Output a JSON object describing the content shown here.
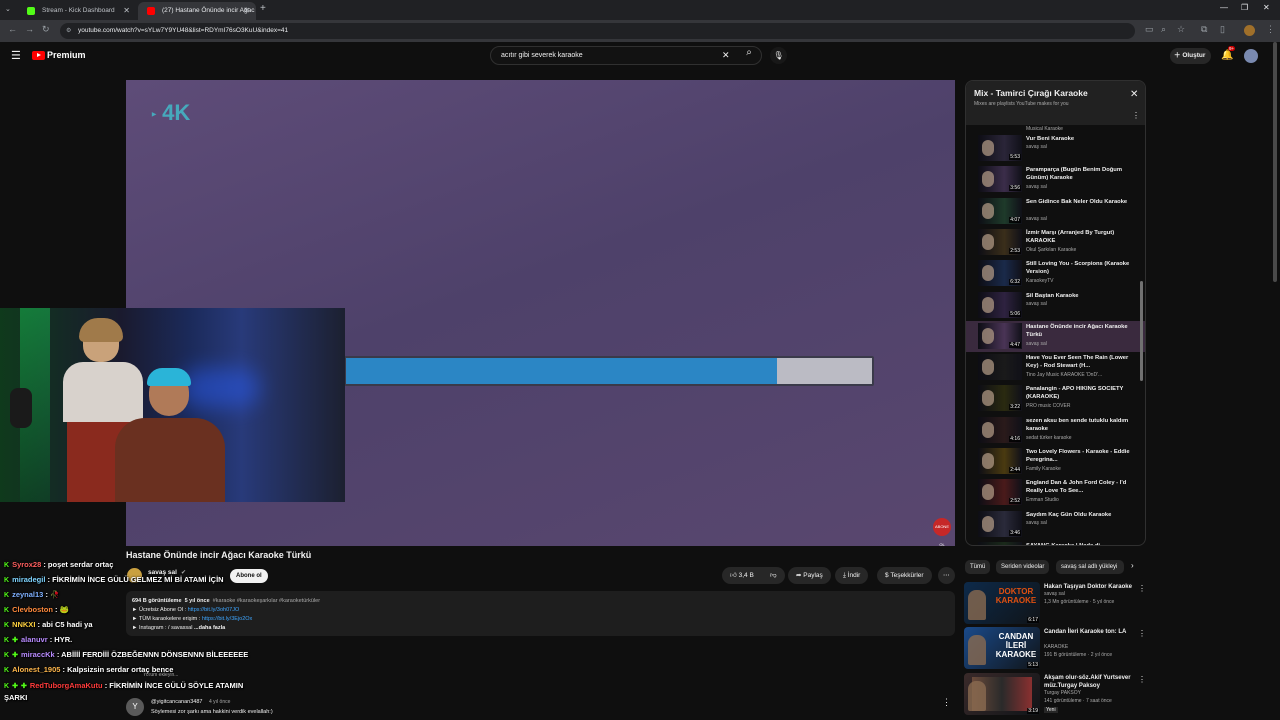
{
  "browser": {
    "tabs": [
      {
        "title": "Stream - Kick Dashboard",
        "favicon_color": "#53fc18"
      },
      {
        "title": "(27) Hastane Önünde incir Ağac",
        "favicon_color": "#ff0000"
      }
    ],
    "url": "youtube.com/watch?v=sYLw7Y9YU48&list=RDYmI76sO3KuU&index=41"
  },
  "youtube": {
    "logo": "Premium",
    "search_value": "acıtır gibi severek karaoke",
    "create_label": "Oluştur",
    "notif_count": "9+"
  },
  "video": {
    "badge": "4K",
    "progress": 0.82,
    "subscribe_badge": "ABONE OL",
    "title": "Hastane Önünde incir Ağacı Karaoke Türkü",
    "channel": "savaş sal",
    "subscribe_label": "Abone ol",
    "likes": "3,4 B",
    "share": "Paylaş",
    "download": "İndir",
    "thanks": "Teşekkürler",
    "views": "694 B görüntüleme",
    "age": "5 yıl önce",
    "tags": "#karaoke #karaokeşarkılar #karaoketürküler",
    "desc_lines": [
      {
        "text": "► Ücretsiz Abone Ol : ",
        "link": "https://bit.ly/3oh07JO"
      },
      {
        "text": "► TÜM karaokelere erişim : ",
        "link": "https://bit.ly/3Ejo2Ox"
      },
      {
        "text": "► Instagram : / savassal",
        "link": "...daha fazla"
      }
    ],
    "comment_author": "@yigitcancanan3487",
    "comment_age": "4 yıl önce",
    "comment_text": "Söylemesi zor şarkı ama hakkini verdik evelallah:)",
    "comment_placeholder": "Yorum ekleyin..."
  },
  "playlist": {
    "title": "Mix - Tamirci Çırağı Karaoke",
    "subtitle": "Mixes are playlists YouTube makes for you",
    "top_channel": "Musical Karaoke",
    "items": [
      {
        "title": "Vur Beni Karaoke",
        "channel": "savaş sal",
        "duration": "5:53",
        "thumb": "#2a2538"
      },
      {
        "title": "Paramparça (Bugün Benim Doğum Günüm) Karaoke",
        "channel": "savaş sal",
        "duration": "3:56",
        "thumb": "#3b2d4a"
      },
      {
        "title": "Sen Gidince Bak Neler Oldu Karaoke",
        "channel": "savaş sal",
        "duration": "4:07",
        "thumb": "#1e3a2a"
      },
      {
        "title": "İzmir Marşı (Arranjed By Turgut) KARAOKE",
        "channel": "Okul Şarkıları Karaoke",
        "duration": "2:53",
        "thumb": "#3a2e1a"
      },
      {
        "title": "Still Loving You - Scorpions (Karaoke Version)",
        "channel": "KaraokeyTV",
        "duration": "6:32",
        "thumb": "#1a2a4a"
      },
      {
        "title": "Sil Baştan Karaoke",
        "channel": "savaş sal",
        "duration": "5:06",
        "thumb": "#2e2240"
      },
      {
        "title": "Hastane Önünde incir Ağacı Karaoke Türkü",
        "channel": "savaş sal",
        "duration": "4:47",
        "thumb": "#4a3456"
      },
      {
        "title": "Have You Ever Seen The Rain (Lower Key) - Rod Stewart (H...",
        "channel": "Tino Jay Music KARAOKE 'DnD'...",
        "duration": "",
        "thumb": "#1a1a1a"
      },
      {
        "title": "Panalangin - APO HIKING SOCIETY (KARAOKE)",
        "channel": "PRO music COVER",
        "duration": "3:22",
        "thumb": "#2a2a10"
      },
      {
        "title": "sezen aksu ben sende tutuklu kaldım karaoke",
        "channel": "sedat türker karaoke",
        "duration": "4:16",
        "thumb": "#2a1a1a"
      },
      {
        "title": "Two Lovely Flowers - Karaoke - Eddie Peregrina...",
        "channel": "Family Karaoke",
        "duration": "2:44",
        "thumb": "#4a3a10"
      },
      {
        "title": "England Dan & John Ford Coley - I'd Really Love To See...",
        "channel": "Emman Studio",
        "duration": "2:52",
        "thumb": "#4a1a1a"
      },
      {
        "title": "Saydım Kaç Gün Oldu Karaoke",
        "channel": "savaş sal",
        "duration": "3:46",
        "thumb": "#2a2a3a"
      },
      {
        "title": "SAYANG Karaoke | Nada di...",
        "channel": "",
        "duration": "",
        "thumb": "#1a2a1a"
      }
    ]
  },
  "chips": [
    "Tümü",
    "Seriden videolar",
    "savaş sal adlı yükleyi"
  ],
  "recommendations": [
    {
      "title": "Hakan Taşıyan Doktor Karaoke",
      "channel": "savaş sal",
      "meta": "1,3 Mn görüntüleme · 5 yıl önce",
      "duration": "6:17",
      "thumb_text": "DOKTOR KARAOKE",
      "thumb_color": "#0d2a4a",
      "thumb_accent": "#e05010"
    },
    {
      "title": "Candan İleri Karaoke  ton: LA",
      "channel": "KARAOKE",
      "meta": "191 B görüntüleme · 2 yıl önce",
      "duration": "5:13",
      "thumb_text": "CANDAN İLERİ KARAOKE",
      "thumb_color": "#1a4a8a",
      "thumb_accent": "#ffffff"
    },
    {
      "title": "Akşam olur-söz.Akif Yurtsever müz.Turgay Paksoy",
      "channel": "Turgay PAKSOY",
      "meta": "141 görüntüleme · 7 saat önce",
      "duration": "3:19",
      "badge": "Yeni",
      "thumb_text": "",
      "thumb_color": "#3a2a2a",
      "thumb_accent": "#aa4444"
    }
  ],
  "chat": [
    {
      "user": "Syrox28",
      "color": "#ff5f5f",
      "text": ": poşet serdar ortaç",
      "icons": 1
    },
    {
      "user": "miradegil",
      "color": "#7fd4ff",
      "text": ": FİKRİMİN İNCE GÜLÜ GELMEZ Mİ Bİ ATAMİ İÇİN",
      "icons": 1
    },
    {
      "user": "zeynal13",
      "color": "#7fb0ff",
      "text": ": 🥀",
      "icons": 1
    },
    {
      "user": "Clevboston",
      "color": "#ff8a3d",
      "text": ": 🐸",
      "icons": 1
    },
    {
      "user": "NNKXI",
      "color": "#ffd23f",
      "text": ": abi C5 hadi ya",
      "icons": 1
    },
    {
      "user": "alanuvr",
      "color": "#b98cff",
      "text": ": HYR.",
      "icons": 2
    },
    {
      "user": "miraccKk",
      "color": "#b98cff",
      "text": ": ABİİİİ FERDİİİ ÖZBEĞENNN DÖNSENNN BİLEEEEEE",
      "icons": 2
    },
    {
      "user": "Alonest_1905",
      "color": "#ffb84d",
      "text": ": Kalpsizsin serdar ortaç bence",
      "icons": 1
    },
    {
      "user": "RedTuborgAmaKutu",
      "color": "#ff3b3b",
      "text": ": FİKRİMİN İNCE GÜLÜ SÖYLE ATAMIN ŞARKI",
      "icons": 3
    }
  ]
}
